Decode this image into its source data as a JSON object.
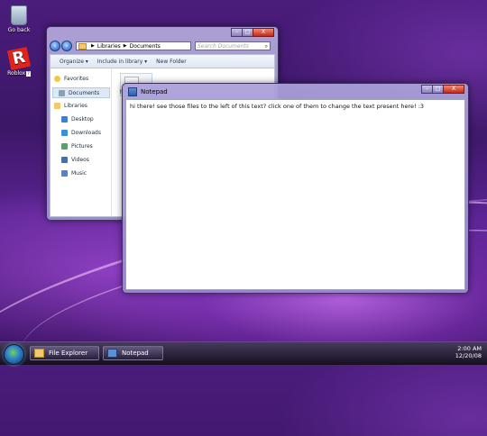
{
  "desktop": {
    "recycle_bin_label": "Go back",
    "roblox_label": "Roblox",
    "roblox_badge": "?"
  },
  "explorer": {
    "title": "",
    "window_controls": {
      "minimize": "–",
      "maximize": "□",
      "close": "X"
    },
    "nav_icons": [
      "back-icon",
      "forward-icon"
    ],
    "breadcrumb": [
      "Libraries",
      "Documents"
    ],
    "search_placeholder": "Search Documents",
    "toolbar": {
      "organize": "Organize ▾",
      "include": "Include in library ▾",
      "new_folder": "New Folder"
    },
    "nav_items": [
      {
        "label": "Favorites",
        "icon": "star-icon"
      },
      {
        "label": "Documents",
        "icon": "documents-icon",
        "selected": true
      },
      {
        "label": "Libraries",
        "icon": "library-icon"
      },
      {
        "label": "Desktop",
        "icon": "desktop-icon"
      },
      {
        "label": "Downloads",
        "icon": "downloads-icon"
      },
      {
        "label": "Pictures",
        "icon": "pictures-icon"
      },
      {
        "label": "Videos",
        "icon": "videos-icon"
      },
      {
        "label": "Music",
        "icon": "music-icon"
      }
    ],
    "file_label": "h"
  },
  "notepad": {
    "title": "Notepad",
    "window_controls": {
      "minimize": "–",
      "maximize": "□",
      "close": "X"
    },
    "text": "hi there! see those files to the left of this text? click one of them to change the text present here! :3"
  },
  "taskbar": {
    "buttons": [
      {
        "label": "File Explorer",
        "icon": "folder-icon"
      },
      {
        "label": "Notepad",
        "icon": "notepad-icon"
      }
    ],
    "time": "2:00 AM",
    "date": "12/20/08"
  },
  "colors": {
    "accent": "#5b2494",
    "close_button": "#c2291b"
  }
}
